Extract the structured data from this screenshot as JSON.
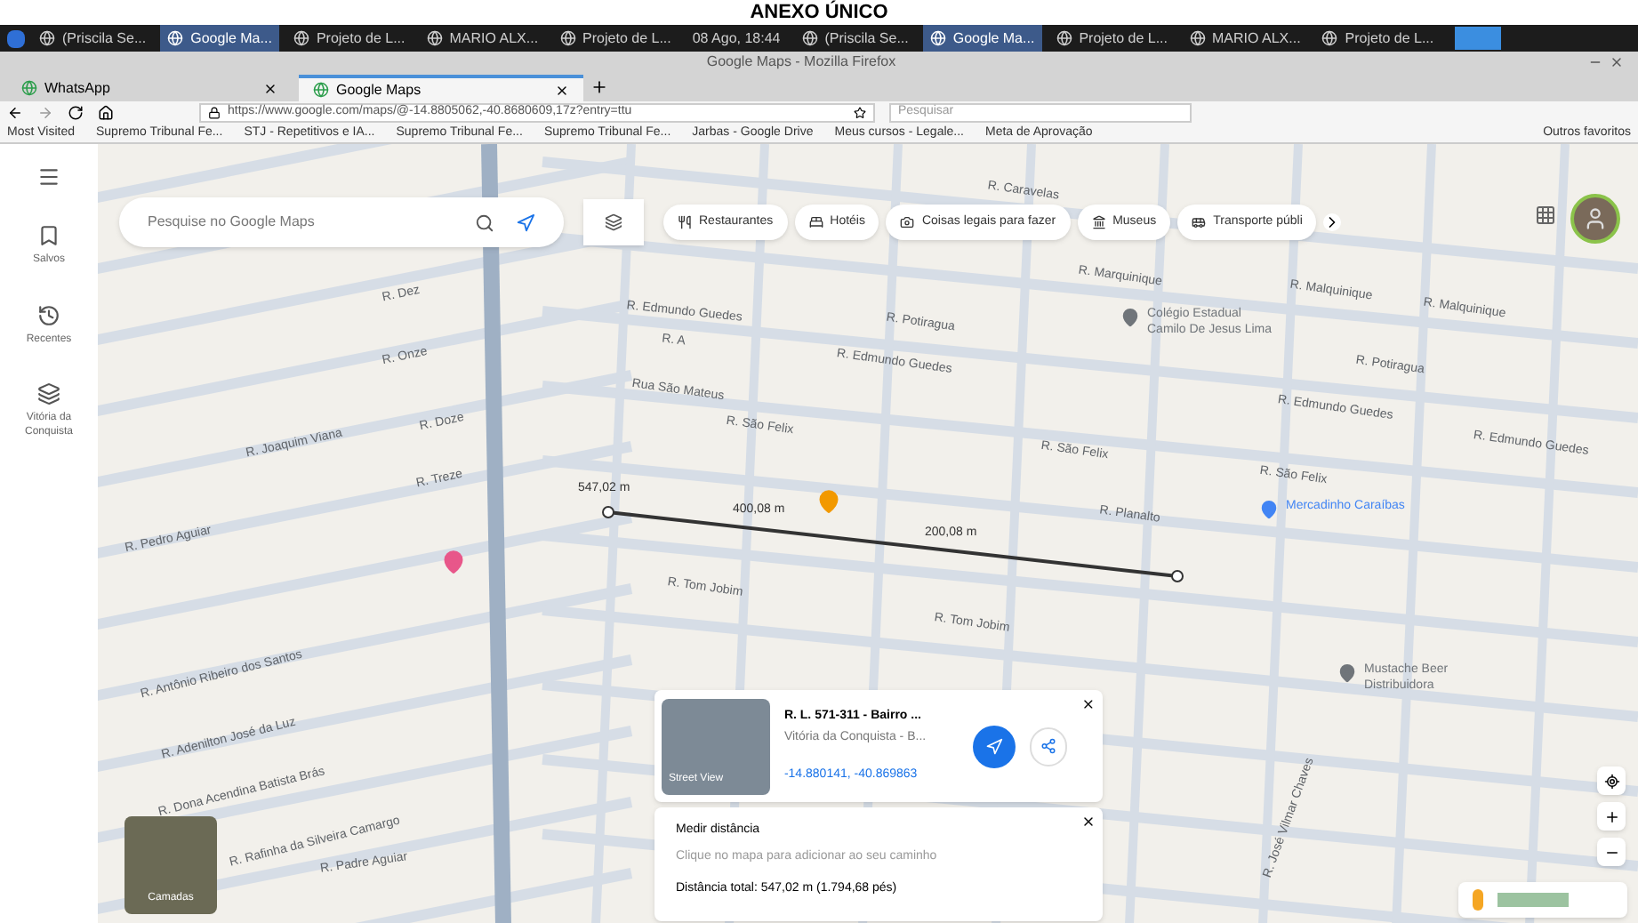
{
  "document_heading": "ANEXO ÚNICO",
  "taskbar": {
    "items": [
      {
        "label": "(Priscila Se...",
        "selected": false
      },
      {
        "label": "Google Ma...",
        "selected": true
      },
      {
        "label": "Projeto de L...",
        "selected": false
      },
      {
        "label": "MARIO ALX...",
        "selected": false
      },
      {
        "label": "Projeto de L...",
        "selected": false
      }
    ],
    "clock": "08 Ago, 18:44",
    "items_2": [
      {
        "label": "(Priscila Se...",
        "selected": false
      },
      {
        "label": "Google Ma...",
        "selected": true
      },
      {
        "label": "Projeto de L...",
        "selected": false
      },
      {
        "label": "MARIO ALX...",
        "selected": false
      },
      {
        "label": "Projeto de L...",
        "selected": false
      }
    ]
  },
  "window": {
    "title": "Google Maps - Mozilla Firefox"
  },
  "tabs": [
    {
      "label": "WhatsApp",
      "selected": false
    },
    {
      "label": "Google Maps",
      "selected": true
    }
  ],
  "address_bar": {
    "url": "https://www.google.com/maps/@-14.8805062,-40.8680609,17z?entry=ttu",
    "search_placeholder": "Pesquisar"
  },
  "bookmarks": [
    "Most Visited",
    "Supremo Tribunal Fe...",
    "STJ - Repetitivos e IA...",
    "Supremo Tribunal Fe...",
    "Supremo Tribunal Fe...",
    "Jarbas - Google Drive",
    "Meus cursos - Legale...",
    "Meta de Aprovação"
  ],
  "other_bookmarks": "Outros favoritos",
  "sidebar": {
    "items": [
      {
        "label": "Salvos"
      },
      {
        "label": "Recentes"
      },
      {
        "label": "Vitória da Conquista"
      }
    ]
  },
  "search": {
    "placeholder": "Pesquise no Google Maps"
  },
  "chips": [
    "Restaurantes",
    "Hotéis",
    "Coisas legais para fazer",
    "Museus",
    "Transporte públi"
  ],
  "map_labels": [
    "R. Caravelas",
    "R. Marquinique",
    "R. Malquinique",
    "R. Malquinique",
    "R. Potiragua",
    "R. Edmundo Guedes",
    "R. A",
    "R. Dez",
    "R. Onze",
    "Rua São Mateus",
    "R. Edmundo Guedes",
    "R. Potiragua",
    "R. Edmundo Guedes",
    "R. São Felix",
    "R. São Felix",
    "R. São Felix",
    "R. Edmundo Guedes",
    "R. Joaquim Viana",
    "R. Doze",
    "R. Treze",
    "R. Pedro Aguiar",
    "R. Planalto",
    "R. Tom Jobim",
    "R. Tom Jobim",
    "R. Antônio Ribeiro dos Santos",
    "R. Adenilton José da Luz",
    "R. Dona Acendina Batista Brás",
    "R. Rafinha da Silveira Camargo",
    "R. Padre Aguiar",
    "R. José Vilmar Chaves"
  ],
  "places": [
    {
      "label": "Colégio Estadual Camilo De Jesus Lima",
      "color": "#70757a"
    },
    {
      "label": "Mercadinho Caraíbas",
      "color": "#4285f4"
    },
    {
      "label": "Mustache Beer Distribuidora",
      "color": "#70757a"
    }
  ],
  "measure_labels": [
    "547,02 m",
    "400,08 m",
    "200,08 m"
  ],
  "place_card": {
    "title": "R. L. 571-311 - Bairro ...",
    "subtitle": "Vitória da Conquista - B...",
    "coordinates": "-14.880141, -40.869863",
    "photo_label": "Street View"
  },
  "measure_card": {
    "title": "Medir distância",
    "hint": "Clique no mapa para adicionar ao seu caminho",
    "total": "Distância total: 547,02 m (1.794,68 pés)"
  },
  "layers_label": "Camadas"
}
